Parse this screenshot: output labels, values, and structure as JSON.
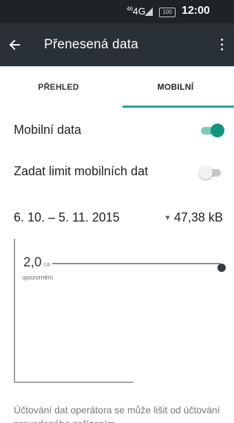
{
  "status_bar": {
    "network": "4G",
    "network_prefix": "46",
    "battery": "100",
    "time": "12:00"
  },
  "app_bar": {
    "title": "Přenesená data",
    "back_icon": "arrow-left-icon",
    "menu_icon": "more-vertical-icon"
  },
  "tabs": [
    {
      "label": "PŘEHLED",
      "selected": false
    },
    {
      "label": "MOBILNÍ",
      "selected": true
    }
  ],
  "settings": {
    "mobile_data": {
      "label": "Mobilní data",
      "enabled": true
    },
    "data_limit": {
      "label": "Zadat limit mobilních dat",
      "enabled": false
    }
  },
  "cycle": {
    "date_range": "6. 10. – 5. 11. 2015",
    "usage": "47,38 kB"
  },
  "chart": {
    "warning_value": "2,0",
    "warning_unit": "GB",
    "warning_label": "upozornění"
  },
  "footnote": "Účtování dat operátora se může lišit od účtování provedeného zařízením.",
  "colors": {
    "accent": "#11957e",
    "app_bar": "#2a3136",
    "status_bar": "#1f2326"
  }
}
